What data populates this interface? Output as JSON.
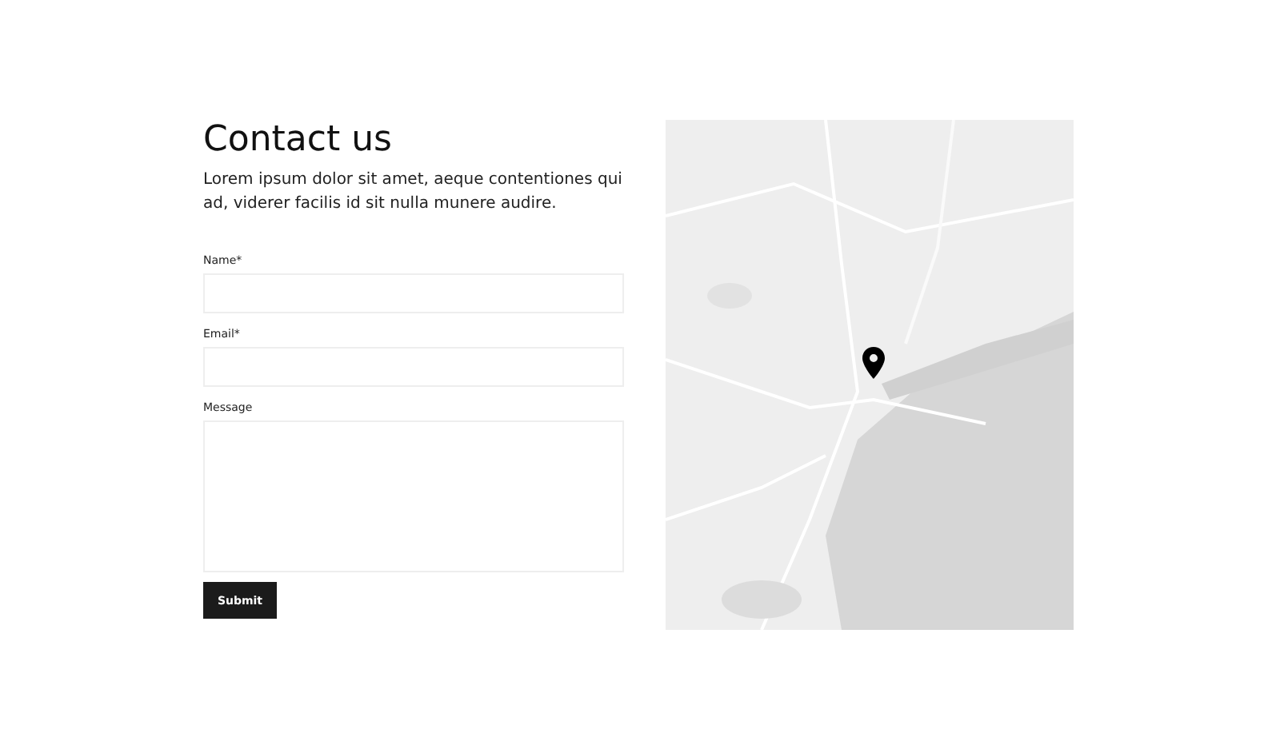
{
  "contact": {
    "title": "Contact us",
    "intro": "Lorem ipsum dolor sit amet, aeque contentiones qui ad, viderer facilis id sit nulla munere audire.",
    "fields": [
      {
        "label": "Name*",
        "kind": "input"
      },
      {
        "label": "Email*",
        "kind": "input"
      },
      {
        "label": "Message",
        "kind": "textarea"
      }
    ],
    "submit": "Submit"
  }
}
